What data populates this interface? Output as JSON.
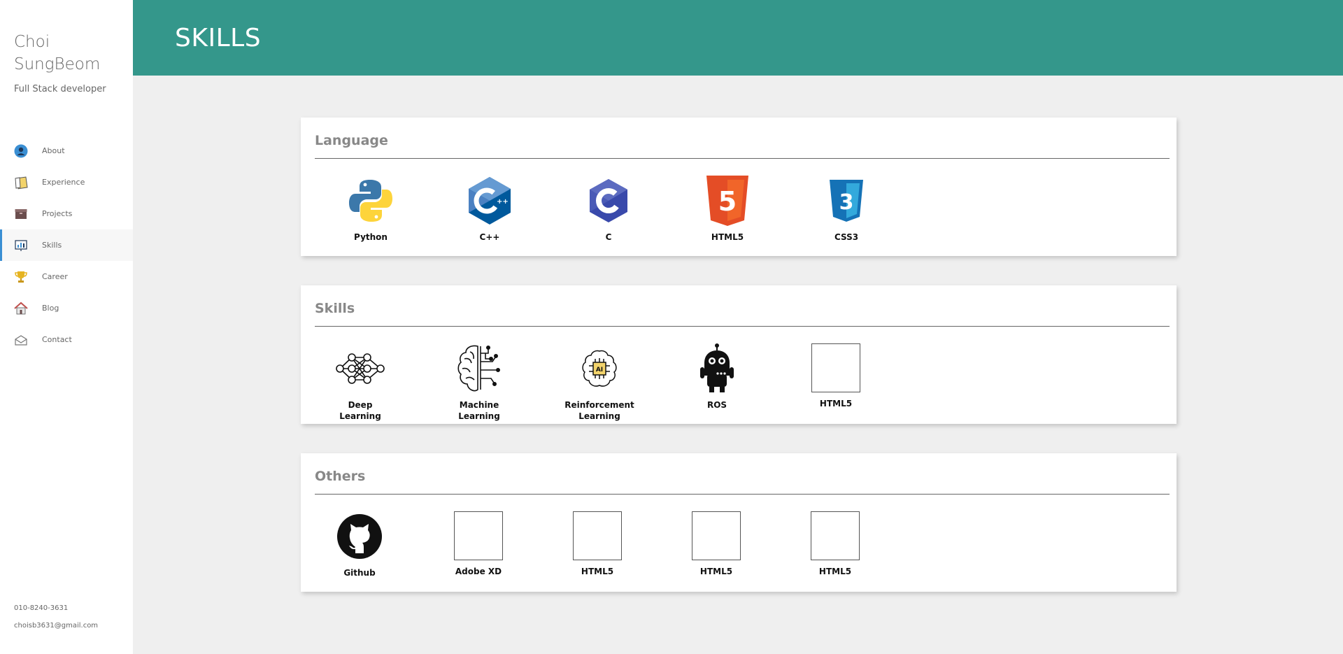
{
  "sidebar": {
    "name": "Choi SungBeom",
    "role": "Full Stack developer",
    "nav": [
      {
        "label": "About",
        "icon": "user-circle-icon"
      },
      {
        "label": "Experience",
        "icon": "notepad-icon"
      },
      {
        "label": "Projects",
        "icon": "box-icon"
      },
      {
        "label": "Skills",
        "icon": "bar-chart-icon"
      },
      {
        "label": "Career",
        "icon": "trophy-icon"
      },
      {
        "label": "Blog",
        "icon": "house-icon"
      },
      {
        "label": "Contact",
        "icon": "envelope-icon"
      }
    ],
    "active": "Skills",
    "phone": "010-8240-3631",
    "email": "choisb3631@gmail.com"
  },
  "header": {
    "title": "SKILLS"
  },
  "sections": [
    {
      "title": "Language",
      "items": [
        {
          "label": "Python",
          "icon": "python-logo-icon"
        },
        {
          "label": "C++",
          "icon": "cpp-logo-icon"
        },
        {
          "label": "C",
          "icon": "c-logo-icon"
        },
        {
          "label": "HTML5",
          "icon": "html5-logo-icon"
        },
        {
          "label": "CSS3",
          "icon": "css3-logo-icon"
        }
      ]
    },
    {
      "title": "Skills",
      "items": [
        {
          "label": "Deep Learning",
          "icon": "neural-network-icon"
        },
        {
          "label": "Machine Learning",
          "icon": "brain-circuit-icon"
        },
        {
          "label": "Reinforcement Learning",
          "icon": "ai-chip-brain-icon"
        },
        {
          "label": "ROS",
          "icon": "robot-icon"
        },
        {
          "label": "HTML5",
          "icon": "placeholder-box-icon"
        }
      ]
    },
    {
      "title": "Others",
      "items": [
        {
          "label": "Github",
          "icon": "github-logo-icon"
        },
        {
          "label": "Adobe XD",
          "icon": "placeholder-box-icon"
        },
        {
          "label": "HTML5",
          "icon": "placeholder-box-icon"
        },
        {
          "label": "HTML5",
          "icon": "placeholder-box-icon"
        },
        {
          "label": "HTML5",
          "icon": "placeholder-box-icon"
        }
      ]
    }
  ],
  "colors": {
    "header": "#34978b",
    "active_indicator": "#3a8fd3",
    "background": "#efefef"
  }
}
